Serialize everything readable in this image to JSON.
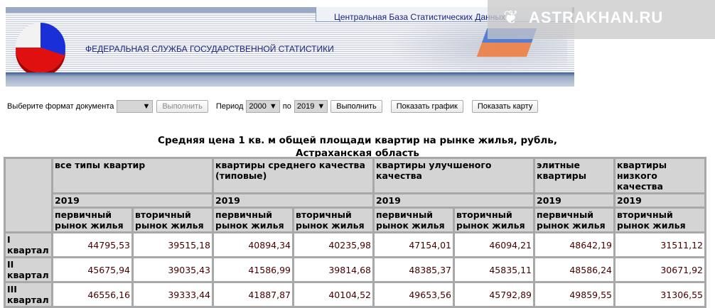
{
  "header": {
    "db_title": "Центральная База Статистических Данных",
    "org_title": "ФЕДЕРАЛЬНАЯ СЛУЖБА ГОСУДАРСТВЕННОЙ СТАТИСТИКИ",
    "watermark": "ASTRAKHAN.RU"
  },
  "controls": {
    "format_label": "Выберите формат документа",
    "format_value": "",
    "execute1": "Выполнить",
    "period_label": "Период",
    "from": "2000",
    "to_label": "по",
    "to": "2019",
    "execute2": "Выполнить",
    "show_chart": "Показать график",
    "show_map": "Показать карту"
  },
  "table": {
    "title1": "Средняя цена 1 кв. м общей площади квартир на рынке жилья, рубль,",
    "title2": "Астраханская область",
    "groups": [
      "все типы квартир",
      "квартиры среднего качества (типовые)",
      "квартиры улучшеного качества",
      "элитные квартиры",
      "квартиры низкого качества"
    ],
    "year": "2019",
    "sub": [
      "первичный рынок жилья",
      "вторичный рынок жилья",
      "первичный рынок жилья",
      "вторичный рынок жилья",
      "первичный рынок жилья",
      "вторичный рынок жилья",
      "первичный рынок жилья",
      "вторичный рынок жилья"
    ],
    "rows": [
      {
        "label": "I квартал",
        "values": [
          "44795,53",
          "39515,18",
          "40894,34",
          "40235,98",
          "47154,01",
          "46094,21",
          "48642,19",
          "31511,12"
        ]
      },
      {
        "label": "II квартал",
        "values": [
          "45675,94",
          "39035,43",
          "41586,99",
          "39814,68",
          "48385,37",
          "45835,11",
          "48586,24",
          "30671,92"
        ]
      },
      {
        "label": "III квартал",
        "values": [
          "46556,16",
          "39333,44",
          "41887,87",
          "40104,52",
          "49653,56",
          "45792,89",
          "49859,55",
          "31306,55"
        ]
      }
    ]
  }
}
